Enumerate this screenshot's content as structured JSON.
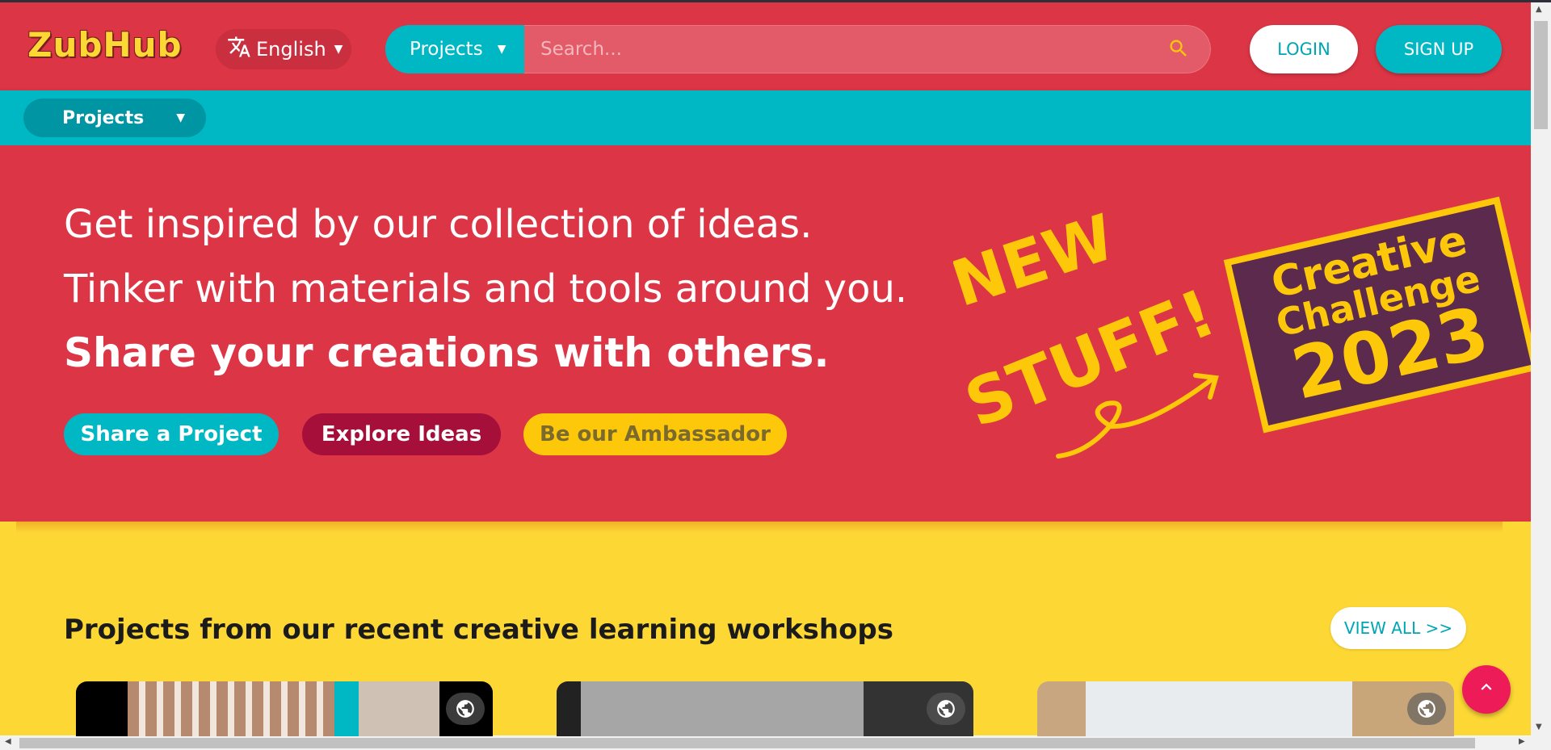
{
  "header": {
    "logo_text": "ZubHub",
    "language": "English",
    "search_category": "Projects",
    "search_placeholder": "Search...",
    "login_label": "LOGIN",
    "signup_label": "SIGN UP"
  },
  "subnav": {
    "projects_label": "Projects"
  },
  "hero": {
    "line1": "Get inspired by our collection of ideas.",
    "line2": "Tinker with materials and tools around you.",
    "line3": "Share your creations with others.",
    "buttons": {
      "share": "Share a Project",
      "explore": "Explore Ideas",
      "ambassador": "Be our Ambassador"
    },
    "new_stuff_text": [
      "NEW",
      "STUFF!"
    ],
    "challenge": {
      "line1": "Creative",
      "line2": "Challenge",
      "year": "2023"
    }
  },
  "projects": {
    "title": "Projects from our recent creative learning workshops",
    "view_all": "VIEW ALL >>"
  },
  "colors": {
    "brand_red": "#dc3545",
    "brand_teal": "#00b8c4",
    "brand_yellow": "#fdd835",
    "explore_maroon": "#a50f3a",
    "scroll_top_pink": "#ee1b59"
  },
  "icons": {
    "language": "translate-icon",
    "search": "search-icon",
    "visibility": "globe-icon",
    "scroll_top": "chevron-up-icon"
  }
}
